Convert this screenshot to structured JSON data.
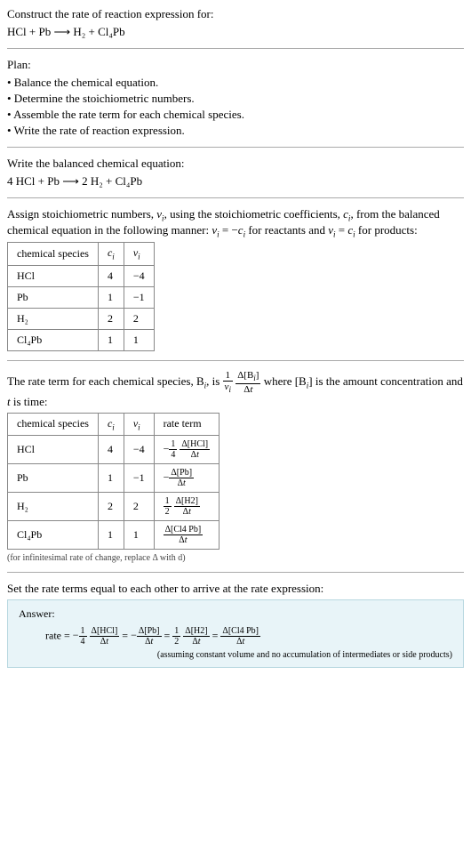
{
  "q": {
    "prompt": "Construct the rate of reaction expression for:",
    "equation": "HCl + Pb  ⟶  H₂ + Cl₄Pb"
  },
  "plan": {
    "title": "Plan:",
    "items": [
      "• Balance the chemical equation.",
      "• Determine the stoichiometric numbers.",
      "• Assemble the rate term for each chemical species.",
      "• Write the rate of reaction expression."
    ]
  },
  "balanced": {
    "title": "Write the balanced chemical equation:",
    "equation": "4 HCl + Pb  ⟶  2 H₂ + Cl₄Pb"
  },
  "stoich": {
    "intro_a": "Assign stoichiometric numbers, ",
    "intro_b": ", using the stoichiometric coefficients, ",
    "intro_c": ", from the balanced chemical equation in the following manner: ",
    "intro_d": " for reactants and ",
    "intro_e": " for products:",
    "table": {
      "headers": [
        "chemical species",
        "cᵢ",
        "νᵢ"
      ],
      "rows": [
        [
          "HCl",
          "4",
          "−4"
        ],
        [
          "Pb",
          "1",
          "−1"
        ],
        [
          "H₂",
          "2",
          "2"
        ],
        [
          "Cl₄Pb",
          "1",
          "1"
        ]
      ]
    }
  },
  "rateterm": {
    "intro_a": "The rate term for each chemical species, B",
    "intro_b": ", is ",
    "intro_c": " where [B",
    "intro_d": "] is the amount concentration and ",
    "intro_e": " is time:",
    "table": {
      "headers": [
        "chemical species",
        "cᵢ",
        "νᵢ",
        "rate term"
      ],
      "rows": [
        {
          "sp": "HCl",
          "c": "4",
          "v": "−4",
          "neg": "−",
          "fnum": "1",
          "fden": "4",
          "dnum": "Δ[HCl]",
          "dden": "Δt"
        },
        {
          "sp": "Pb",
          "c": "1",
          "v": "−1",
          "neg": "−",
          "fnum": "",
          "fden": "",
          "dnum": "Δ[Pb]",
          "dden": "Δt"
        },
        {
          "sp": "H₂",
          "c": "2",
          "v": "2",
          "neg": "",
          "fnum": "1",
          "fden": "2",
          "dnum": "Δ[H2]",
          "dden": "Δt"
        },
        {
          "sp": "Cl₄Pb",
          "c": "1",
          "v": "1",
          "neg": "",
          "fnum": "",
          "fden": "",
          "dnum": "Δ[Cl4 Pb]",
          "dden": "Δt"
        }
      ]
    },
    "note": "(for infinitesimal rate of change, replace Δ with d)"
  },
  "final": {
    "intro": "Set the rate terms equal to each other to arrive at the rate expression:",
    "answer_label": "Answer:",
    "rate_prefix": "rate = ",
    "terms": [
      {
        "neg": "−",
        "fnum": "1",
        "fden": "4",
        "dnum": "Δ[HCl]",
        "dden": "Δt"
      },
      {
        "neg": "−",
        "fnum": "",
        "fden": "",
        "dnum": "Δ[Pb]",
        "dden": "Δt"
      },
      {
        "neg": "",
        "fnum": "1",
        "fden": "2",
        "dnum": "Δ[H2]",
        "dden": "Δt"
      },
      {
        "neg": "",
        "fnum": "",
        "fden": "",
        "dnum": "Δ[Cl4 Pb]",
        "dden": "Δt"
      }
    ],
    "eq": " = ",
    "note": "(assuming constant volume and no accumulation of intermediates or side products)"
  }
}
